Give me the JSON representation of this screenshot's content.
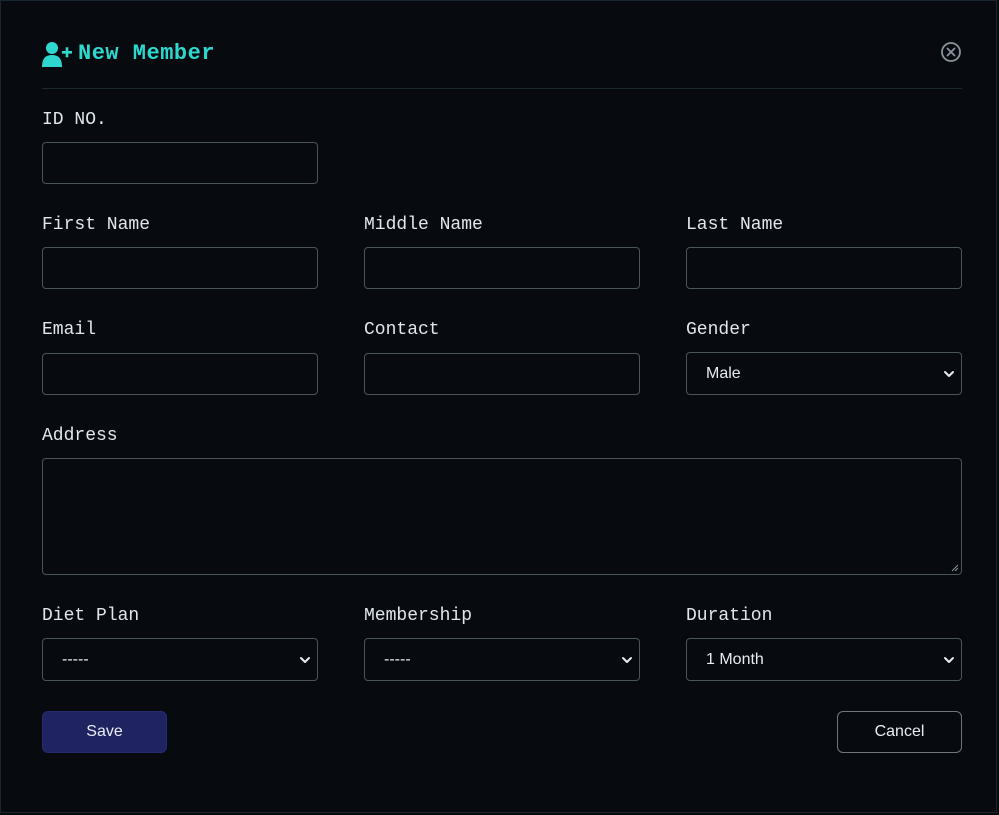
{
  "header": {
    "title": "New Member",
    "icon": "user-plus-icon",
    "close_icon": "close-circle-icon"
  },
  "form": {
    "id_no": {
      "label": "ID NO.",
      "value": ""
    },
    "first_name": {
      "label": "First Name",
      "value": ""
    },
    "middle_name": {
      "label": "Middle Name",
      "value": ""
    },
    "last_name": {
      "label": "Last Name",
      "value": ""
    },
    "email": {
      "label": "Email",
      "value": ""
    },
    "contact": {
      "label": "Contact",
      "value": ""
    },
    "gender": {
      "label": "Gender",
      "selected": "Male"
    },
    "address": {
      "label": "Address",
      "value": ""
    },
    "diet_plan": {
      "label": "Diet Plan",
      "selected": "-----"
    },
    "membership": {
      "label": "Membership",
      "selected": "-----"
    },
    "duration": {
      "label": "Duration",
      "selected": "1 Month"
    }
  },
  "actions": {
    "save_label": "Save",
    "cancel_label": "Cancel"
  },
  "colors": {
    "background": "#070b0f",
    "accent": "#2fd8cf",
    "save_button": "#1f2460",
    "border": "#4a545c"
  }
}
